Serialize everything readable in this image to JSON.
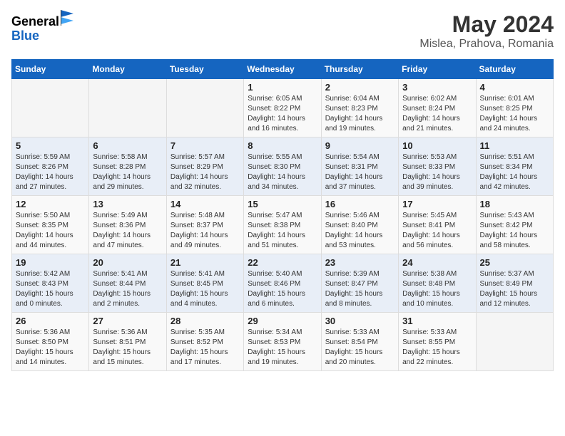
{
  "header": {
    "logo_general": "General",
    "logo_blue": "Blue",
    "month_title": "May 2024",
    "location": "Mislea, Prahova, Romania"
  },
  "days_of_week": [
    "Sunday",
    "Monday",
    "Tuesday",
    "Wednesday",
    "Thursday",
    "Friday",
    "Saturday"
  ],
  "weeks": [
    [
      {
        "day": "",
        "info": ""
      },
      {
        "day": "",
        "info": ""
      },
      {
        "day": "",
        "info": ""
      },
      {
        "day": "1",
        "info": "Sunrise: 6:05 AM\nSunset: 8:22 PM\nDaylight: 14 hours\nand 16 minutes."
      },
      {
        "day": "2",
        "info": "Sunrise: 6:04 AM\nSunset: 8:23 PM\nDaylight: 14 hours\nand 19 minutes."
      },
      {
        "day": "3",
        "info": "Sunrise: 6:02 AM\nSunset: 8:24 PM\nDaylight: 14 hours\nand 21 minutes."
      },
      {
        "day": "4",
        "info": "Sunrise: 6:01 AM\nSunset: 8:25 PM\nDaylight: 14 hours\nand 24 minutes."
      }
    ],
    [
      {
        "day": "5",
        "info": "Sunrise: 5:59 AM\nSunset: 8:26 PM\nDaylight: 14 hours\nand 27 minutes."
      },
      {
        "day": "6",
        "info": "Sunrise: 5:58 AM\nSunset: 8:28 PM\nDaylight: 14 hours\nand 29 minutes."
      },
      {
        "day": "7",
        "info": "Sunrise: 5:57 AM\nSunset: 8:29 PM\nDaylight: 14 hours\nand 32 minutes."
      },
      {
        "day": "8",
        "info": "Sunrise: 5:55 AM\nSunset: 8:30 PM\nDaylight: 14 hours\nand 34 minutes."
      },
      {
        "day": "9",
        "info": "Sunrise: 5:54 AM\nSunset: 8:31 PM\nDaylight: 14 hours\nand 37 minutes."
      },
      {
        "day": "10",
        "info": "Sunrise: 5:53 AM\nSunset: 8:33 PM\nDaylight: 14 hours\nand 39 minutes."
      },
      {
        "day": "11",
        "info": "Sunrise: 5:51 AM\nSunset: 8:34 PM\nDaylight: 14 hours\nand 42 minutes."
      }
    ],
    [
      {
        "day": "12",
        "info": "Sunrise: 5:50 AM\nSunset: 8:35 PM\nDaylight: 14 hours\nand 44 minutes."
      },
      {
        "day": "13",
        "info": "Sunrise: 5:49 AM\nSunset: 8:36 PM\nDaylight: 14 hours\nand 47 minutes."
      },
      {
        "day": "14",
        "info": "Sunrise: 5:48 AM\nSunset: 8:37 PM\nDaylight: 14 hours\nand 49 minutes."
      },
      {
        "day": "15",
        "info": "Sunrise: 5:47 AM\nSunset: 8:38 PM\nDaylight: 14 hours\nand 51 minutes."
      },
      {
        "day": "16",
        "info": "Sunrise: 5:46 AM\nSunset: 8:40 PM\nDaylight: 14 hours\nand 53 minutes."
      },
      {
        "day": "17",
        "info": "Sunrise: 5:45 AM\nSunset: 8:41 PM\nDaylight: 14 hours\nand 56 minutes."
      },
      {
        "day": "18",
        "info": "Sunrise: 5:43 AM\nSunset: 8:42 PM\nDaylight: 14 hours\nand 58 minutes."
      }
    ],
    [
      {
        "day": "19",
        "info": "Sunrise: 5:42 AM\nSunset: 8:43 PM\nDaylight: 15 hours\nand 0 minutes."
      },
      {
        "day": "20",
        "info": "Sunrise: 5:41 AM\nSunset: 8:44 PM\nDaylight: 15 hours\nand 2 minutes."
      },
      {
        "day": "21",
        "info": "Sunrise: 5:41 AM\nSunset: 8:45 PM\nDaylight: 15 hours\nand 4 minutes."
      },
      {
        "day": "22",
        "info": "Sunrise: 5:40 AM\nSunset: 8:46 PM\nDaylight: 15 hours\nand 6 minutes."
      },
      {
        "day": "23",
        "info": "Sunrise: 5:39 AM\nSunset: 8:47 PM\nDaylight: 15 hours\nand 8 minutes."
      },
      {
        "day": "24",
        "info": "Sunrise: 5:38 AM\nSunset: 8:48 PM\nDaylight: 15 hours\nand 10 minutes."
      },
      {
        "day": "25",
        "info": "Sunrise: 5:37 AM\nSunset: 8:49 PM\nDaylight: 15 hours\nand 12 minutes."
      }
    ],
    [
      {
        "day": "26",
        "info": "Sunrise: 5:36 AM\nSunset: 8:50 PM\nDaylight: 15 hours\nand 14 minutes."
      },
      {
        "day": "27",
        "info": "Sunrise: 5:36 AM\nSunset: 8:51 PM\nDaylight: 15 hours\nand 15 minutes."
      },
      {
        "day": "28",
        "info": "Sunrise: 5:35 AM\nSunset: 8:52 PM\nDaylight: 15 hours\nand 17 minutes."
      },
      {
        "day": "29",
        "info": "Sunrise: 5:34 AM\nSunset: 8:53 PM\nDaylight: 15 hours\nand 19 minutes."
      },
      {
        "day": "30",
        "info": "Sunrise: 5:33 AM\nSunset: 8:54 PM\nDaylight: 15 hours\nand 20 minutes."
      },
      {
        "day": "31",
        "info": "Sunrise: 5:33 AM\nSunset: 8:55 PM\nDaylight: 15 hours\nand 22 minutes."
      },
      {
        "day": "",
        "info": ""
      }
    ]
  ]
}
